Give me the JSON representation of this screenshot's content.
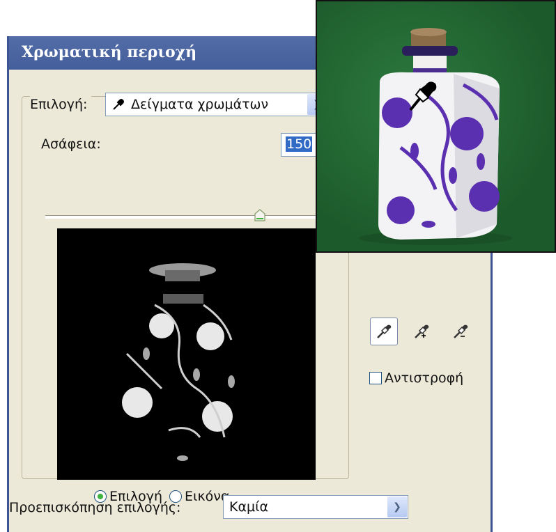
{
  "dialog": {
    "title": "Χρωματική περιοχή",
    "select_label": "Επιλογή:",
    "select_value": "Δείγματα χρωμάτων",
    "fuzziness_label": "Ασάφεια:",
    "fuzziness_value": "150",
    "fuzziness_level": 0.75,
    "radio_selection": "Επιλογή",
    "radio_image": "Εικόνα",
    "invert_label": "Αντιστροφή",
    "preview_label": "Προεπισκόπηση επιλογής:",
    "preview_value": "Καμία"
  },
  "icons": [
    "eyedropper-icon",
    "eyedropper-plus-icon",
    "eyedropper-minus-icon",
    "chevron-down-icon"
  ],
  "colors": {
    "titlebar": "#445e9b",
    "dialog_bg": "#ece9d8",
    "highlight": "#316ac5",
    "photo_bg": "#1d5a2b",
    "pattern": "#5a2fb0"
  }
}
